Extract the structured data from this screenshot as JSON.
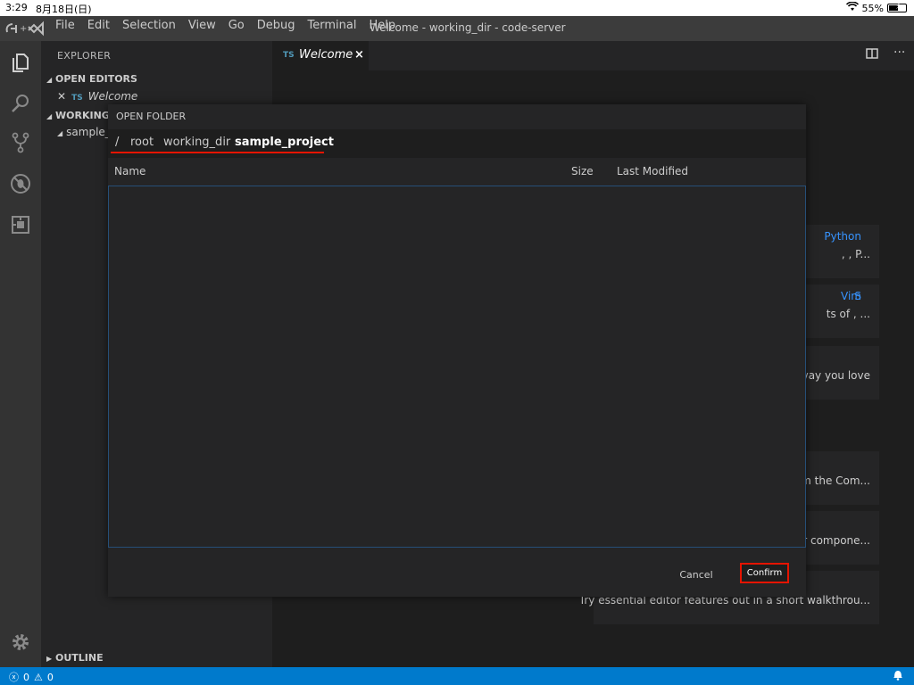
{
  "ios": {
    "time": "3:29",
    "date": "8月18日(日)",
    "battery": "55%",
    "battery_level": 0.55
  },
  "titlebar": {
    "menus": [
      "File",
      "Edit",
      "Selection",
      "View",
      "Go",
      "Debug",
      "Terminal",
      "Help"
    ],
    "title": "Welcome - working_dir - code-server"
  },
  "sidebar": {
    "header": "EXPLORER",
    "open_editors": {
      "label": "OPEN EDITORS",
      "file_lang": "TS",
      "file": "Welcome"
    },
    "workspace": {
      "label": "WORKING_",
      "child": "sample_"
    },
    "outline": "OUTLINE"
  },
  "editor": {
    "tab": {
      "lang": "TS",
      "label": "Welcome",
      "close": "×"
    },
    "cards": [
      {
        "text": ", Python, P...",
        "links": [
          "Python"
        ]
      },
      {
        "text": "ts of Vim, S...",
        "links": [
          "Vim"
        ]
      },
      {
        "text": "vay you love"
      },
      {
        "text": "om the Com..."
      },
      {
        "text": "r compone..."
      },
      {
        "text": "Try essential editor features out in a short walkthrou..."
      }
    ]
  },
  "dialog": {
    "title": "OPEN FOLDER",
    "breadcrumbs": [
      "/",
      "root",
      "working_dir",
      "sample_project"
    ],
    "columns": {
      "name": "Name",
      "size": "Size",
      "modified": "Last Modified"
    },
    "cancel": "Cancel",
    "confirm": "Confirm"
  },
  "statusbar": {
    "errors": "0",
    "warnings": "0"
  },
  "colors": {
    "accent": "#007acc",
    "highlight": "#e51400",
    "link": "#3794ff"
  }
}
